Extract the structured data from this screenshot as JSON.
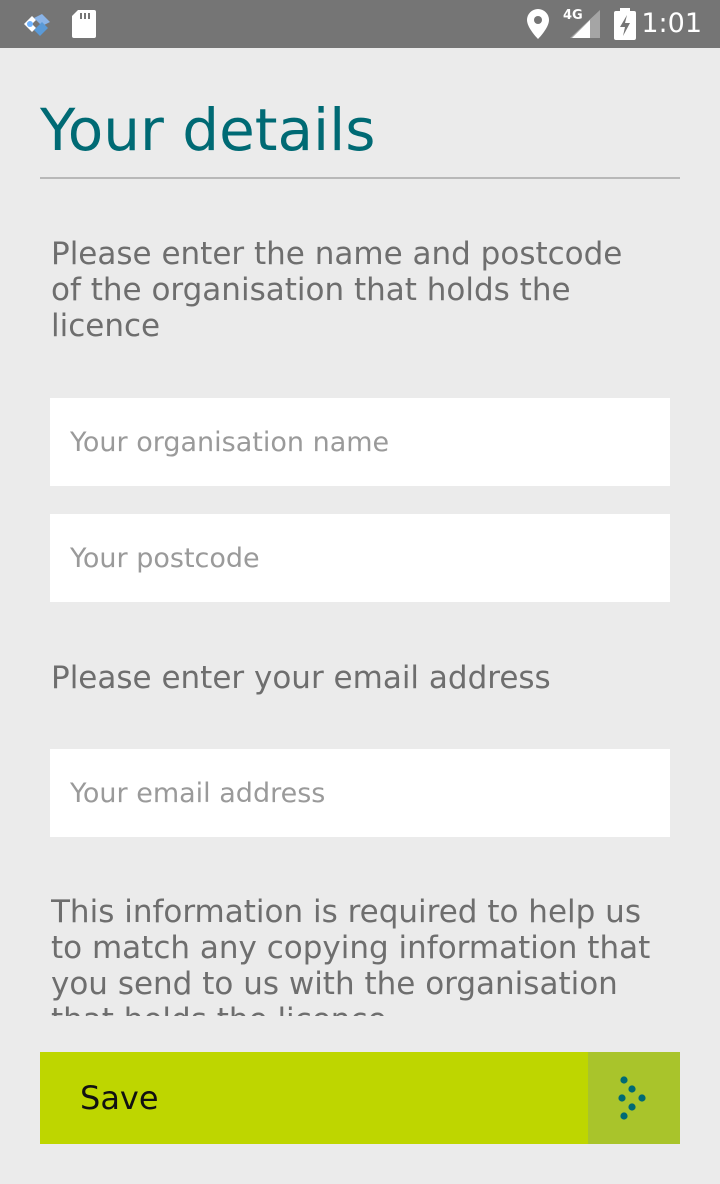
{
  "status_bar": {
    "time": "1:01",
    "network": "4G",
    "icons": [
      "app-notification-icon",
      "sd-card-icon",
      "location-icon",
      "signal-icon",
      "battery-charging-icon"
    ]
  },
  "page": {
    "title": "Your details",
    "org_prompt": "Please enter the name and postcode of the organisation that holds the licence",
    "org_name_placeholder": "Your organisation name",
    "org_name_value": "",
    "postcode_placeholder": "Your postcode",
    "postcode_value": "",
    "email_prompt": "Please enter your email address",
    "email_placeholder": "Your email address",
    "email_value": "",
    "info_text": "This information is required to help us to match any copying information that you send to us with the organisation that holds the licence"
  },
  "actions": {
    "save_label": "Save",
    "save_icon": "dotted-arrow-icon"
  },
  "colors": {
    "status_bar": "#757575",
    "background": "#ebebeb",
    "title": "#006a74",
    "accent": "#bed600",
    "accent_dark": "#a9c42b",
    "arrow_dots": "#006a74"
  }
}
